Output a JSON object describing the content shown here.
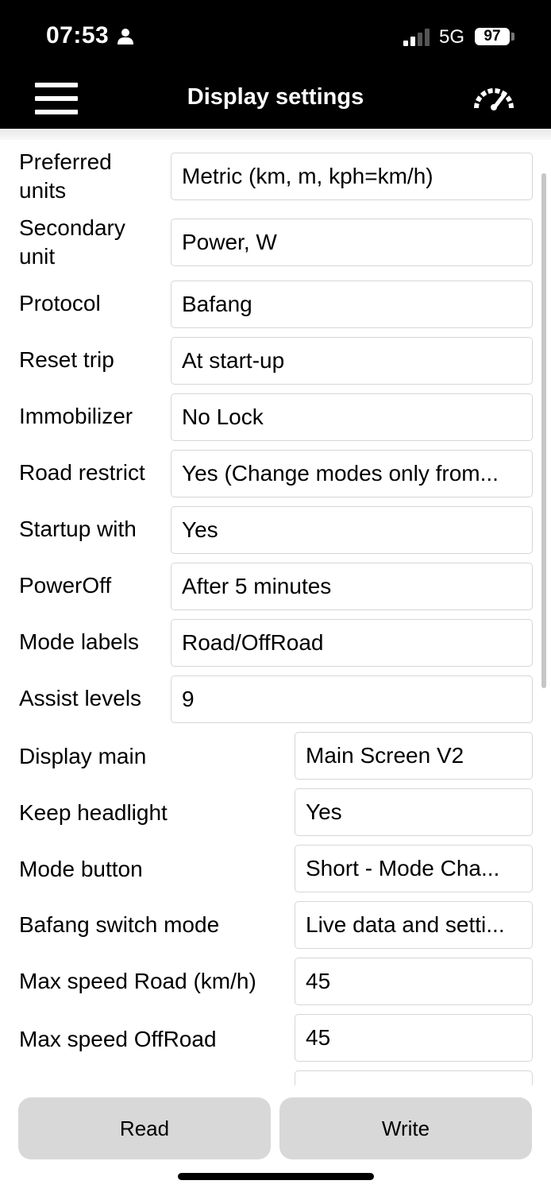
{
  "status_bar": {
    "time": "07:53",
    "network": "5G",
    "battery": "97",
    "icons": [
      "person-icon",
      "signal-icon",
      "battery-icon"
    ]
  },
  "nav": {
    "title": "Display settings",
    "menu_icon": "hamburger-menu-icon",
    "right_icon": "speedometer-icon"
  },
  "settings": [
    {
      "label": "Preferred units",
      "value": "Metric (km, m, kph=km/h)"
    },
    {
      "label": "Secondary unit",
      "value": "Power, W"
    },
    {
      "label": "Protocol",
      "value": "Bafang"
    },
    {
      "label": "Reset trip",
      "value": "At start-up"
    },
    {
      "label": "Immobilizer",
      "value": "No Lock"
    },
    {
      "label": "Road restrict",
      "value": "Yes (Change modes only from..."
    },
    {
      "label": "Startup with",
      "value": "Yes"
    },
    {
      "label": "PowerOff",
      "value": "After 5 minutes"
    },
    {
      "label": "Mode labels",
      "value": "Road/OffRoad"
    },
    {
      "label": "Assist levels",
      "value": "9"
    },
    {
      "label": "Display main",
      "value": "Main Screen V2"
    },
    {
      "label": "Keep headlight",
      "value": "Yes"
    },
    {
      "label": "Mode button",
      "value": "Short - Mode Cha..."
    },
    {
      "label": "Bafang switch mode",
      "value": "Live data and setti..."
    },
    {
      "label": "Max speed Road (km/h)",
      "value": "45"
    },
    {
      "label": "Max speed OffRoad",
      "value": "45"
    }
  ],
  "buttons": {
    "read": "Read",
    "write": "Write"
  }
}
